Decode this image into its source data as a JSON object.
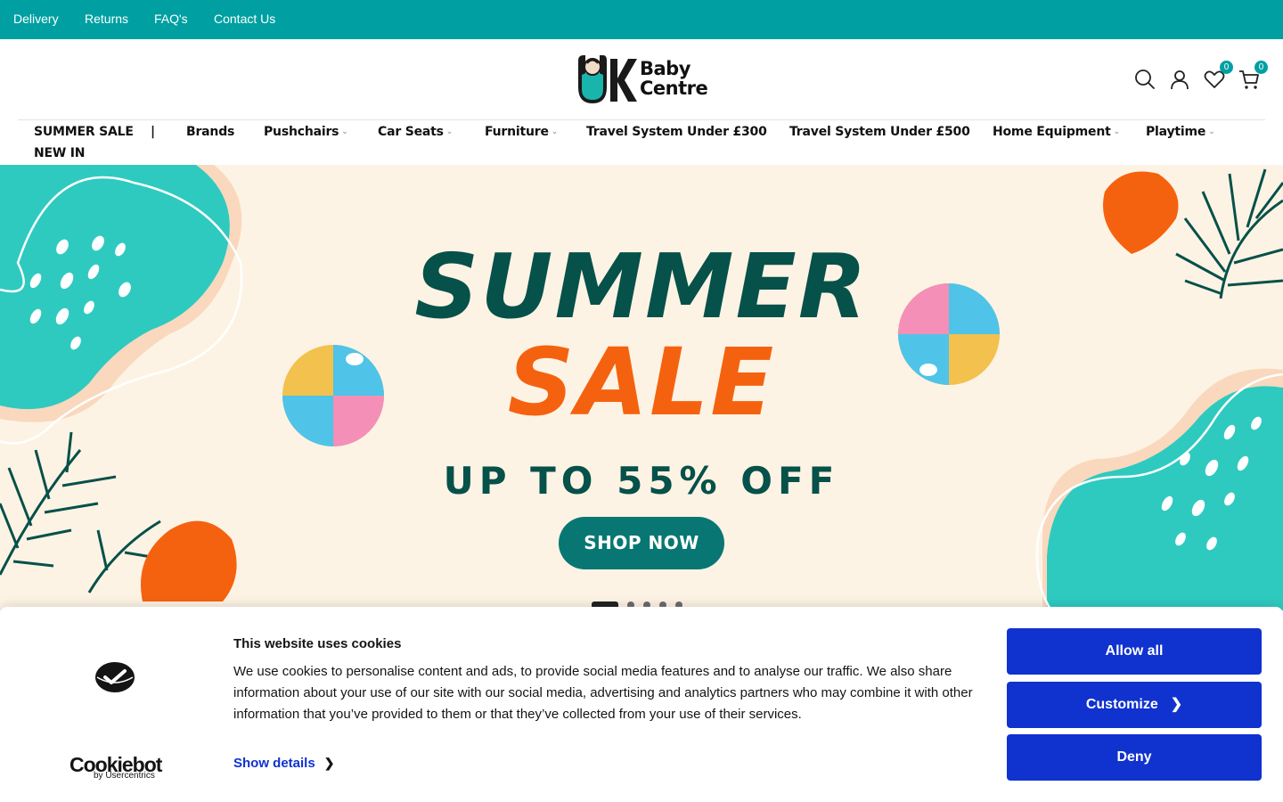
{
  "topbar": {
    "links": [
      "Delivery",
      "Returns",
      "FAQ's",
      "Contact Us"
    ],
    "bg_color": "#00a0a2"
  },
  "header": {
    "logo_line1": "Baby",
    "logo_line2": "Centre",
    "logo_letter": "UK",
    "wishlist_count": "0",
    "cart_count": "0",
    "icons": [
      "search-icon",
      "account-icon",
      "heart-icon",
      "cart-icon"
    ]
  },
  "nav": {
    "items": [
      {
        "label": "SUMMER SALE",
        "dropdown": false
      },
      {
        "label": "|",
        "dropdown": false
      },
      {
        "label": "Brands",
        "dropdown": false
      },
      {
        "label": "Pushchairs",
        "dropdown": true
      },
      {
        "label": "Car Seats",
        "dropdown": true
      },
      {
        "label": "Furniture",
        "dropdown": true
      },
      {
        "label": "Travel System Under £300",
        "dropdown": false
      },
      {
        "label": "Travel System Under £500",
        "dropdown": false
      },
      {
        "label": "Home Equipment",
        "dropdown": true
      },
      {
        "label": "Playtime",
        "dropdown": true
      },
      {
        "label": "NEW IN",
        "dropdown": false
      }
    ]
  },
  "banner": {
    "title_line1": "SUMMER",
    "title_line2": "SALE",
    "subtitle": "UP TO 55% OFF",
    "cta": "SHOP NOW",
    "slide_count": 5,
    "active_slide": 1,
    "colors": {
      "bg": "#fdf3e4",
      "teal": "#2ecac0",
      "dark_green": "#06514a",
      "orange": "#f5620f"
    }
  },
  "cookie": {
    "title": "This website uses cookies",
    "body": "We use cookies to personalise content and ads, to provide social media features and to analyse our traffic. We also share information about your use of our site with our social media, advertising and analytics partners who may combine it with other information that you’ve provided to them or that they’ve collected from your use of their services.",
    "show_details": "Show details",
    "brand": "Cookiebot",
    "brand_sub": "by Usercentrics",
    "buttons": {
      "allow_all": "Allow all",
      "customize": "Customize",
      "deny": "Deny"
    },
    "accent_color": "#1032cf"
  }
}
